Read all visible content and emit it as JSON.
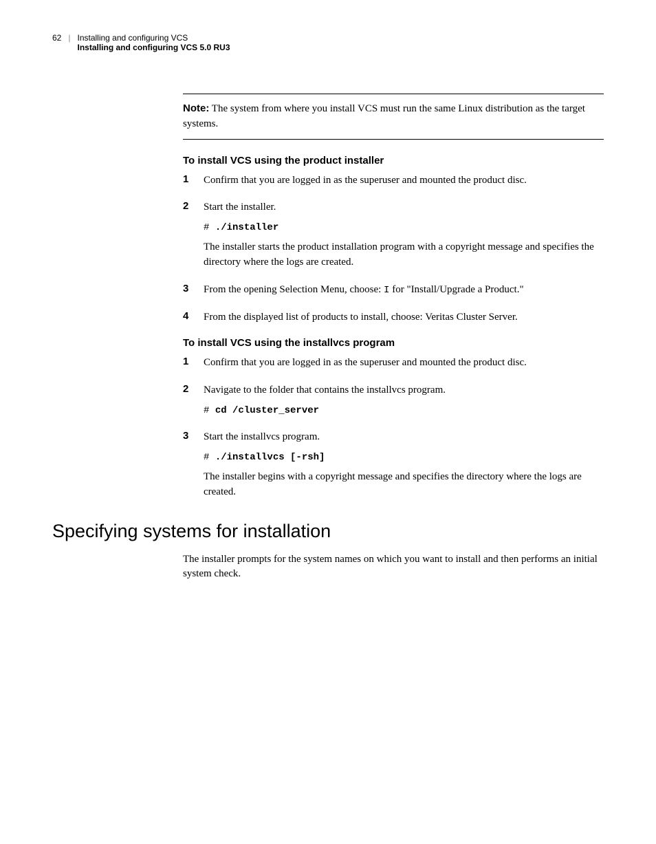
{
  "header": {
    "page_number": "62",
    "separator": "|",
    "chapter": "Installing and configuring VCS",
    "section": "Installing and configuring VCS 5.0 RU3"
  },
  "note": {
    "label": "Note:",
    "text": " The system from where you install VCS must run the same Linux distribution as the target systems."
  },
  "proc1": {
    "title": "To install VCS using the product installer",
    "step1": {
      "num": "1",
      "text": "Confirm that you are logged in as the superuser and mounted the product disc."
    },
    "step2": {
      "num": "2",
      "text": "Start the installer.",
      "code_prefix": "# ",
      "code": "./installer",
      "after": "The installer starts the product installation program with a copyright message and specifies the directory where the logs are created."
    },
    "step3": {
      "num": "3",
      "text_before": "From the opening Selection Menu, choose: ",
      "code_inline": "I",
      "text_after": " for \"Install/Upgrade a Product.\""
    },
    "step4": {
      "num": "4",
      "text": "From the displayed list of products to install, choose: Veritas Cluster Server."
    }
  },
  "proc2": {
    "title": "To install VCS using the installvcs program",
    "step1": {
      "num": "1",
      "text": "Confirm that you are logged in as the superuser and mounted the product disc."
    },
    "step2": {
      "num": "2",
      "text": "Navigate to the folder that contains the installvcs program.",
      "code_prefix": "# ",
      "code": "cd /cluster_server"
    },
    "step3": {
      "num": "3",
      "text": "Start the installvcs program.",
      "code_prefix": "# ",
      "code": "./installvcs [-rsh]",
      "after": "The installer begins with a copyright message and specifies the directory where the logs are created."
    }
  },
  "section2": {
    "heading": "Specifying systems for installation",
    "body": "The installer prompts for the system names on which you want to install and then performs an initial system check."
  }
}
